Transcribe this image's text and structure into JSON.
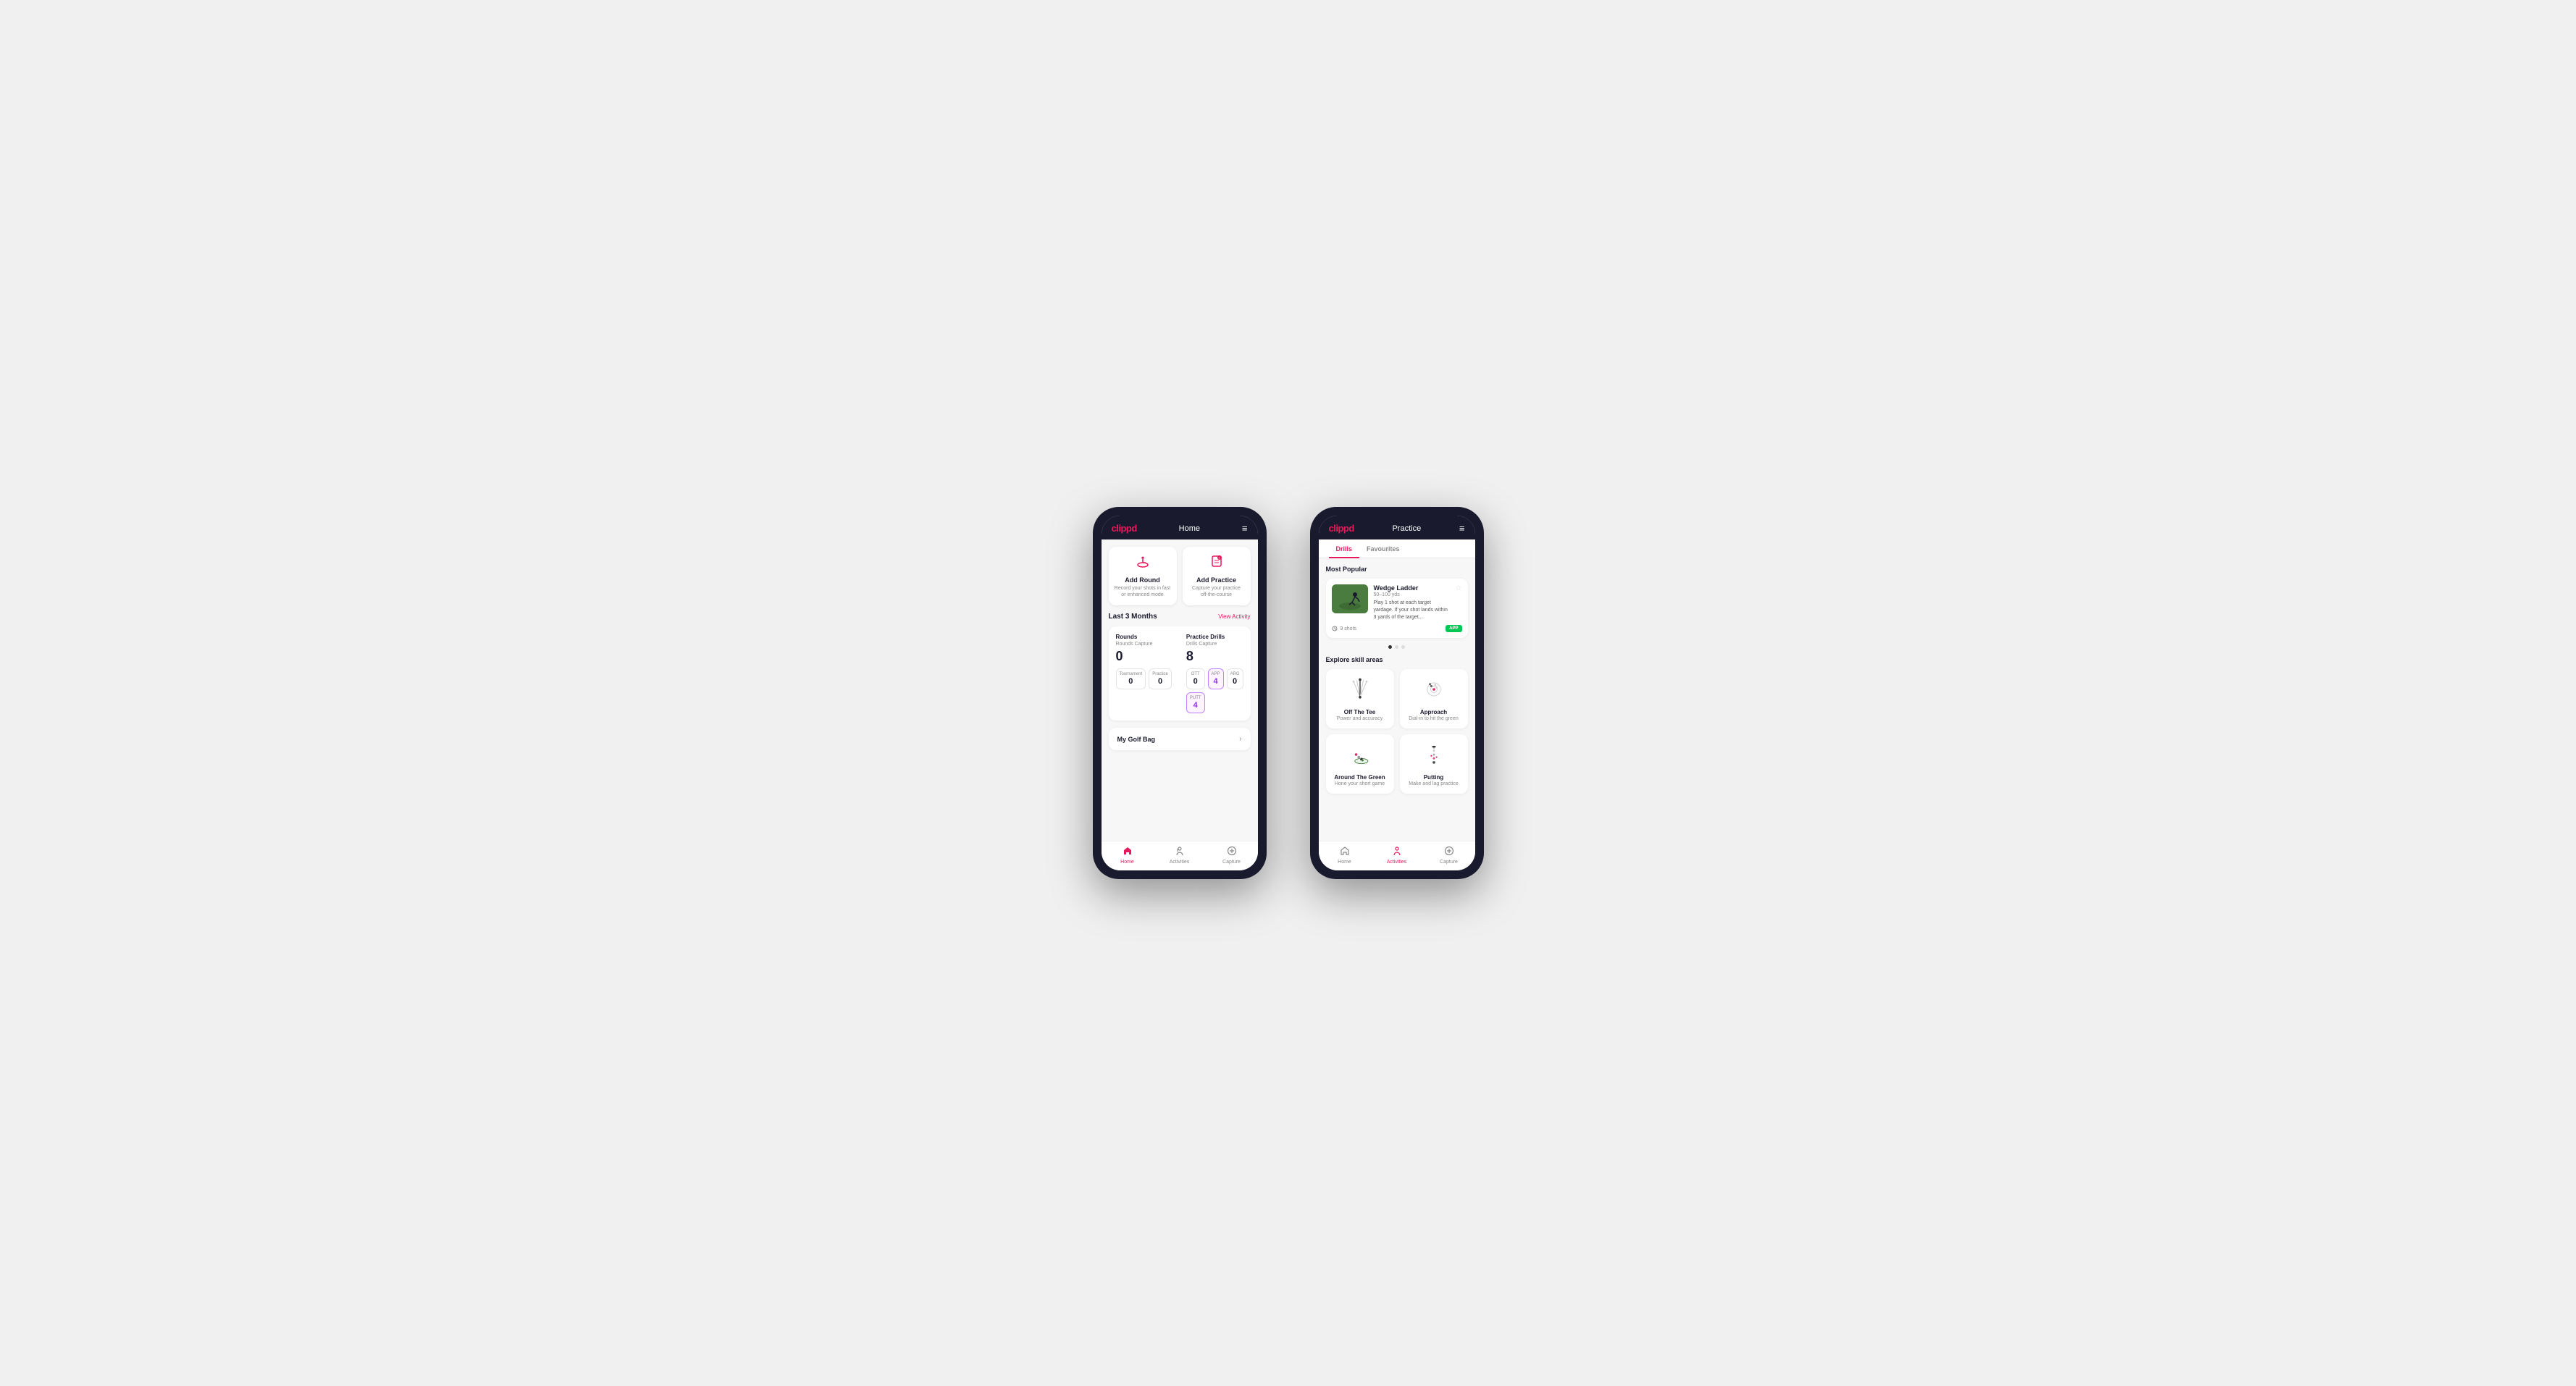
{
  "phone1": {
    "topbar": {
      "logo": "clippd",
      "title": "Home",
      "menu_icon": "≡"
    },
    "action_cards": [
      {
        "id": "add-round",
        "icon": "⛳",
        "title": "Add Round",
        "subtitle": "Record your shots in fast or enhanced mode"
      },
      {
        "id": "add-practice",
        "icon": "📋",
        "title": "Add Practice",
        "subtitle": "Capture your practice off-the-course"
      }
    ],
    "activity": {
      "title": "Last 3 Months",
      "link": "View Activity"
    },
    "rounds": {
      "title": "Rounds",
      "capture_label": "Rounds Capture",
      "total": "0",
      "cells": [
        {
          "label": "Tournament",
          "value": "0",
          "highlight": false
        },
        {
          "label": "Practice",
          "value": "0",
          "highlight": false
        }
      ]
    },
    "practice_drills": {
      "title": "Practice Drills",
      "capture_label": "Drills Capture",
      "total": "8",
      "cells": [
        {
          "label": "OTT",
          "value": "0",
          "highlight": false
        },
        {
          "label": "APP",
          "value": "4",
          "highlight": true
        },
        {
          "label": "ARG",
          "value": "0",
          "highlight": false
        },
        {
          "label": "PUTT",
          "value": "4",
          "highlight": true
        }
      ]
    },
    "golf_bag": {
      "title": "My Golf Bag"
    },
    "nav": [
      {
        "label": "Home",
        "icon": "🏠",
        "active": true
      },
      {
        "label": "Activities",
        "icon": "⛺",
        "active": false
      },
      {
        "label": "Capture",
        "icon": "➕",
        "active": false
      }
    ]
  },
  "phone2": {
    "topbar": {
      "logo": "clippd",
      "title": "Practice",
      "menu_icon": "≡"
    },
    "tabs": [
      {
        "label": "Drills",
        "active": true
      },
      {
        "label": "Favourites",
        "active": false
      }
    ],
    "most_popular": {
      "label": "Most Popular",
      "drill": {
        "name": "Wedge Ladder",
        "yardage": "50–100 yds",
        "description": "Play 1 shot at each target yardage. If your shot lands within 3 yards of the target...",
        "shots": "9 shots",
        "badge": "APP"
      }
    },
    "explore": {
      "label": "Explore skill areas",
      "skills": [
        {
          "id": "off-the-tee",
          "name": "Off The Tee",
          "subtitle": "Power and accuracy"
        },
        {
          "id": "approach",
          "name": "Approach",
          "subtitle": "Dial-in to hit the green"
        },
        {
          "id": "around-the-green",
          "name": "Around The Green",
          "subtitle": "Hone your short game"
        },
        {
          "id": "putting",
          "name": "Putting",
          "subtitle": "Make and lag practice"
        }
      ]
    },
    "nav": [
      {
        "label": "Home",
        "icon": "🏠",
        "active": false
      },
      {
        "label": "Activities",
        "icon": "⛺",
        "active": true
      },
      {
        "label": "Capture",
        "icon": "➕",
        "active": false
      }
    ]
  }
}
